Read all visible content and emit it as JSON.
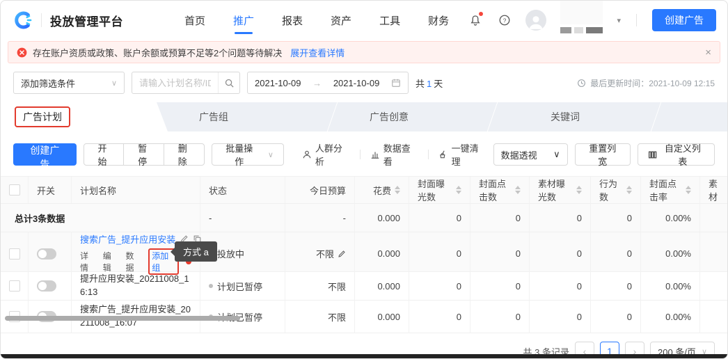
{
  "colors": {
    "primary": "#2979ff",
    "danger": "#f5473b",
    "annotation": "#e23b2e",
    "status_green": "#30bf78"
  },
  "icons": {
    "chevron_down": "∨",
    "caret_down": "▾",
    "close": "×",
    "arrow_right": "→",
    "prev": "‹",
    "next": "›",
    "help": "?"
  },
  "header": {
    "title": "投放管理平台",
    "nav": [
      {
        "label": "首页"
      },
      {
        "label": "推广"
      },
      {
        "label": "报表"
      },
      {
        "label": "资产"
      },
      {
        "label": "工具"
      },
      {
        "label": "财务"
      }
    ],
    "create_ad_button": "创建广告"
  },
  "alert": {
    "message": "存在账户资质或政策、账户余额或预算不足等2个问题等待解决",
    "link": "展开查看详情"
  },
  "filters": {
    "add_filter": "添加筛选条件",
    "search_placeholder": "请输入计划名称/ID",
    "date_start": "2021-10-09",
    "date_end": "2021-10-09",
    "days_prefix": "共",
    "days_num": "1",
    "days_suffix": "天",
    "last_update": "最后更新时间：2021-10-09 12:15"
  },
  "tabs": [
    {
      "label": "广告计划"
    },
    {
      "label": "广告组"
    },
    {
      "label": "广告创意"
    },
    {
      "label": "关键词"
    }
  ],
  "toolbar": {
    "create": "创建广告",
    "start": "开始",
    "pause": "暂停",
    "delete": "删除",
    "batch": "批量操作",
    "audience": "人群分析",
    "data_view": "数据查看",
    "clean": "一键清理",
    "pivot": "数据透视",
    "reset_width": "重置列宽",
    "custom_columns": "自定义列表"
  },
  "table": {
    "columns": [
      "开关",
      "计划名称",
      "状态",
      "今日预算",
      "花费",
      "封面曝光数",
      "封面点击数",
      "素材曝光数",
      "行为数",
      "封面点击率",
      "素材"
    ],
    "tooltip": "方式 a",
    "summary": {
      "label": "总计3条数据",
      "status": "-",
      "budget": "-",
      "cost": "0.000",
      "cover_impressions": "0",
      "cover_clicks": "0",
      "material_impressions": "0",
      "actions": "0",
      "cover_ctr": "0.00%"
    },
    "rows": [
      {
        "name": "搜索广告_提升应用安装",
        "links": [
          "详情",
          "编辑",
          "数据",
          "添加组"
        ],
        "status": "投放中",
        "budget": "不限",
        "cost": "0.000",
        "cover_impressions": "0",
        "cover_clicks": "0",
        "material_impressions": "0",
        "actions": "0",
        "cover_ctr": "0.00%"
      },
      {
        "name": "提升应用安装_20211008_16:13",
        "status": "计划已暂停",
        "budget": "不限",
        "cost": "0.000",
        "cover_impressions": "0",
        "cover_clicks": "0",
        "material_impressions": "0",
        "actions": "0",
        "cover_ctr": "0.00%"
      },
      {
        "name": "搜索广告_提升应用安装_20211008_16:07",
        "status": "计划已暂停",
        "budget": "不限",
        "cost": "0.000",
        "cover_impressions": "0",
        "cover_clicks": "0",
        "material_impressions": "0",
        "actions": "0",
        "cover_ctr": "0.00%"
      }
    ]
  },
  "pagination": {
    "total": "共 3 条记录",
    "page": "1",
    "page_size": "200 条/页"
  }
}
